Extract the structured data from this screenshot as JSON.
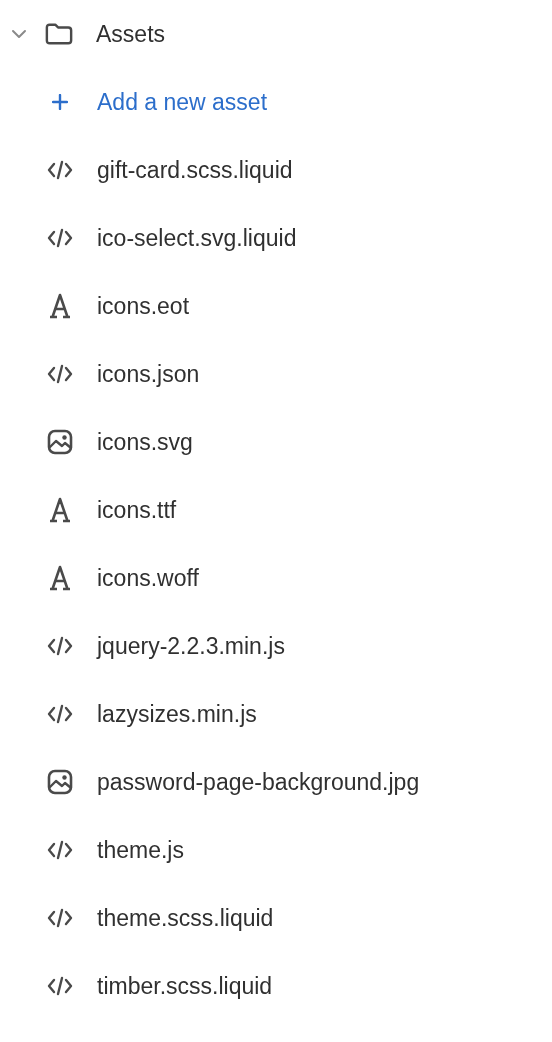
{
  "folder": {
    "name": "Assets",
    "expanded": true
  },
  "add_action": {
    "label": "Add a new asset"
  },
  "files": [
    {
      "name": "gift-card.scss.liquid",
      "kind": "code"
    },
    {
      "name": "ico-select.svg.liquid",
      "kind": "code"
    },
    {
      "name": "icons.eot",
      "kind": "font"
    },
    {
      "name": "icons.json",
      "kind": "code"
    },
    {
      "name": "icons.svg",
      "kind": "image"
    },
    {
      "name": "icons.ttf",
      "kind": "font"
    },
    {
      "name": "icons.woff",
      "kind": "font"
    },
    {
      "name": "jquery-2.2.3.min.js",
      "kind": "code"
    },
    {
      "name": "lazysizes.min.js",
      "kind": "code"
    },
    {
      "name": "password-page-background.jpg",
      "kind": "image"
    },
    {
      "name": "theme.js",
      "kind": "code"
    },
    {
      "name": "theme.scss.liquid",
      "kind": "code"
    },
    {
      "name": "timber.scss.liquid",
      "kind": "code"
    }
  ]
}
